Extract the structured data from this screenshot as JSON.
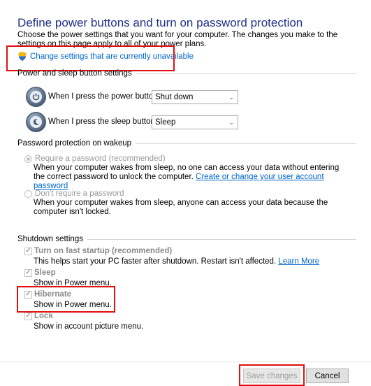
{
  "header": {
    "title": "Define power buttons and turn on password protection",
    "description": "Choose the power settings that you want for your computer. The changes you make to the settings on this page apply to all of your power plans.",
    "uac_link": "Change settings that are currently unavailable"
  },
  "power_sleep": {
    "section": "Power and sleep button settings",
    "power_label": "When I press the power button:",
    "power_value": "Shut down",
    "sleep_label": "When I press the sleep button:",
    "sleep_value": "Sleep"
  },
  "password": {
    "section": "Password protection on wakeup",
    "require_title": "Require a password (recommended)",
    "require_desc": "When your computer wakes from sleep, no one can access your data without entering the correct password to unlock the computer.",
    "require_link": "Create or change your user account password",
    "norequire_title": "Don't require a password",
    "norequire_desc": "When your computer wakes from sleep, anyone can access your data because the computer isn't locked."
  },
  "shutdown": {
    "section": "Shutdown settings",
    "items": [
      {
        "title": "Turn on fast startup (recommended)",
        "desc": "This helps start your PC faster after shutdown. Restart isn't affected.",
        "link": "Learn More",
        "checked": true
      },
      {
        "title": "Sleep",
        "desc": "Show in Power menu.",
        "checked": true
      },
      {
        "title": "Hibernate",
        "desc": "Show in Power menu.",
        "checked": false
      },
      {
        "title": "Lock",
        "desc": "Show in account picture menu.",
        "checked": true
      }
    ]
  },
  "footer": {
    "save": "Save changes",
    "cancel": "Cancel"
  },
  "icons": {
    "shield": "uac-shield-icon",
    "power": "power-button-icon",
    "sleep": "sleep-button-icon"
  },
  "colors": {
    "title": "#1e3287",
    "link": "#0066cc",
    "highlight": "#e01010"
  }
}
